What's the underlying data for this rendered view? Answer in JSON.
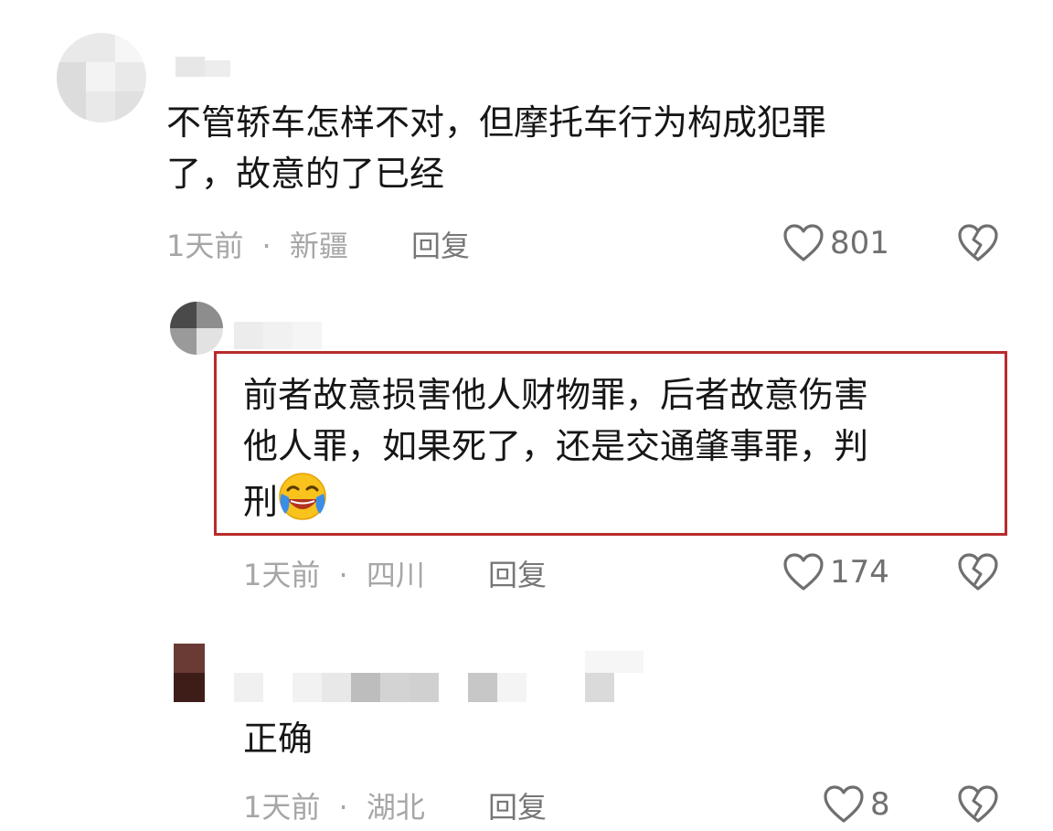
{
  "comments": [
    {
      "text": "不管轿车怎样不对，但摩托车行为构成犯罪了，故意的了已经",
      "line1": "不管轿车怎样不对，但摩托车行为构成犯罪",
      "line2": "了，故意的了已经",
      "time": "1天前",
      "location": "新疆",
      "reply_label": "回复",
      "likes": "801"
    },
    {
      "text": "前者故意损害他人财物罪，后者故意伤害他人罪，如果死了，还是交通肇事罪，判刑",
      "line1": "前者故意损害他人财物罪，后者故意伤害",
      "line2": "他人罪，如果死了，还是交通肇事罪，判",
      "line3": "刑",
      "time": "1天前",
      "location": "四川",
      "reply_label": "回复",
      "likes": "174"
    },
    {
      "text": "正确",
      "time": "1天前",
      "location": "湖北",
      "reply_label": "回复",
      "likes": "8"
    }
  ],
  "separator": "·",
  "colors": {
    "highlight_border": "#b82b2b",
    "meta_gray": "#a6a6a6",
    "icon_gray": "#6f6f6f"
  },
  "icons": [
    "heart-outline-icon",
    "broken-heart-icon",
    "laughing-crying-emoji"
  ]
}
